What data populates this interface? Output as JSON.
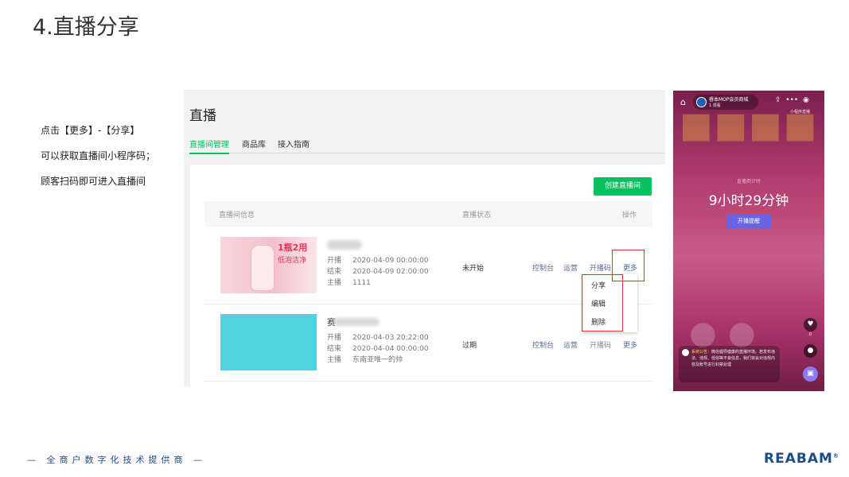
{
  "slide": {
    "title": "4.直播分享",
    "instructions": [
      "点击【更多】-【分享】",
      "可以获取直播间小程序码；",
      "顾客扫码即可进入直播间"
    ],
    "footer_tagline": "— 全商户数字化技术提供商 —",
    "brand": "REABAM"
  },
  "admin": {
    "title": "直播",
    "tabs": [
      {
        "label": "直播间管理",
        "active": true
      },
      {
        "label": "商品库",
        "active": false
      },
      {
        "label": "接入指南",
        "active": false
      }
    ],
    "create_button": "创建直播间",
    "columns": [
      "直播间信息",
      "直播状态",
      "操作"
    ],
    "rows": [
      {
        "thumb_text1": "1瓶2用",
        "thumb_text2": "低泡洁净",
        "start_label": "开播",
        "start": "2020-04-09 00:00:00",
        "end_label": "结束",
        "end": "2020-04-09 02:00:00",
        "host_label": "主播",
        "host": "1111",
        "status": "未开始",
        "ops": [
          "控制台",
          "运营",
          "开播码",
          "更多"
        ]
      },
      {
        "name_prefix": "赛",
        "start_label": "开播",
        "start": "2020-04-03 20:22:00",
        "end_label": "结束",
        "end": "2020-04-04 00:00:00",
        "host_label": "主播",
        "host": "东南亚唯一的帅",
        "status": "过期",
        "ops": [
          "控制台",
          "运营",
          "开播码",
          "更多"
        ]
      }
    ],
    "more_menu": [
      "分享",
      "编辑",
      "删除"
    ],
    "highlight_color": "#e62e2e",
    "accent_color": "#07c160",
    "link_color": "#576b95"
  },
  "phone": {
    "store_name": "睿本MOP会员商城",
    "views": "1 观看",
    "mini_program_label": "小程序直播",
    "countdown_label": "直播倒计时",
    "countdown": "9小时29分钟",
    "remind_button": "开播提醒",
    "notice_label": "系统公告：",
    "notice_text": "微信倡导健康的直播环境。若发布违法、违规、低俗等不良信息，我们将会对违规内容及账号进行封禁处理",
    "like_count": "0",
    "icons": [
      "home-icon",
      "share-icon",
      "more-icon",
      "close-icon",
      "heart-icon",
      "comment-icon",
      "bag-icon"
    ]
  }
}
